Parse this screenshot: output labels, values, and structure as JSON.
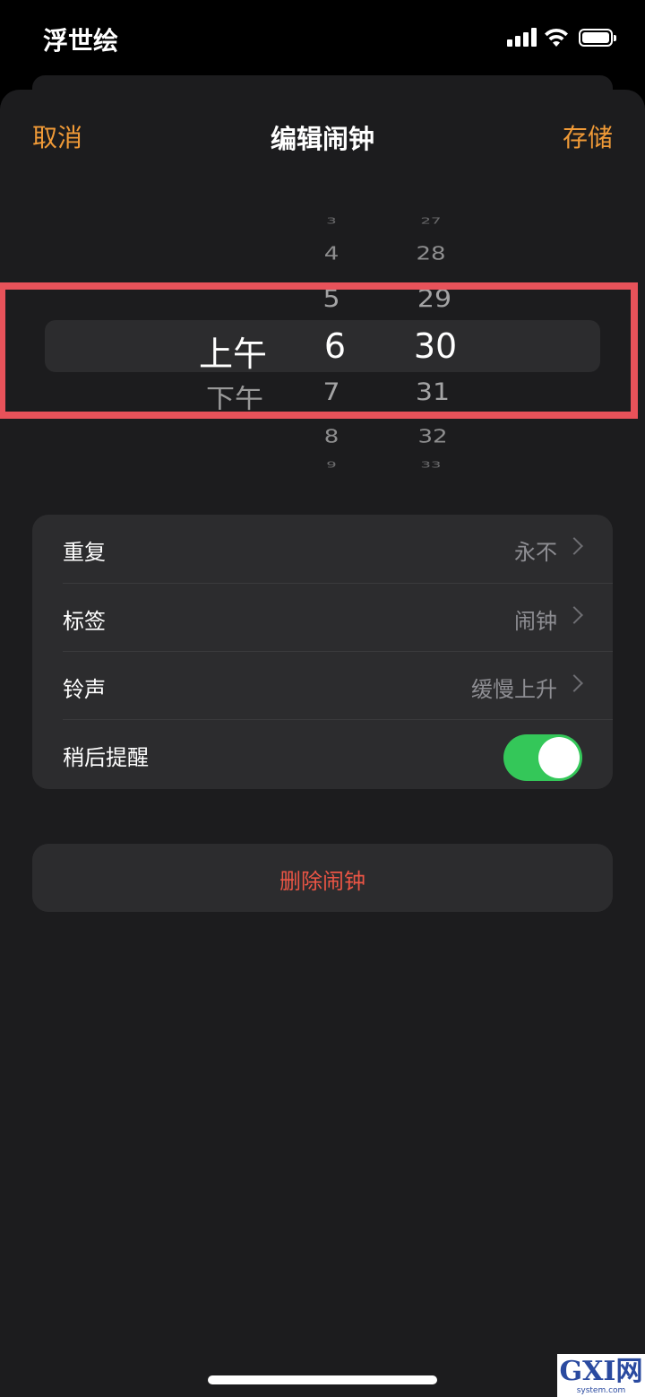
{
  "status": {
    "carrier": "浮世绘"
  },
  "nav": {
    "cancel": "取消",
    "title": "编辑闹钟",
    "save": "存储"
  },
  "picker": {
    "period": {
      "selected": "上午",
      "below": "下午"
    },
    "hours": {
      "above": [
        "3",
        "4",
        "5"
      ],
      "selected": "6",
      "below": [
        "7",
        "8",
        "9"
      ]
    },
    "minutes": {
      "above": [
        "27",
        "28",
        "29"
      ],
      "selected": "30",
      "below": [
        "31",
        "32",
        "33"
      ]
    }
  },
  "settings": {
    "repeat": {
      "label": "重复",
      "value": "永不"
    },
    "label": {
      "label": "标签",
      "value": "闹钟"
    },
    "sound": {
      "label": "铃声",
      "value": "缓慢上升"
    },
    "snooze": {
      "label": "稍后提醒",
      "on": true
    }
  },
  "delete": {
    "label": "删除闹钟"
  },
  "watermark": {
    "text": "GXI网",
    "sub": "system.com"
  },
  "colors": {
    "accent": "#f09a37",
    "toggle_on": "#34c759",
    "destructive": "#eb5545",
    "highlight": "#e8525a"
  }
}
